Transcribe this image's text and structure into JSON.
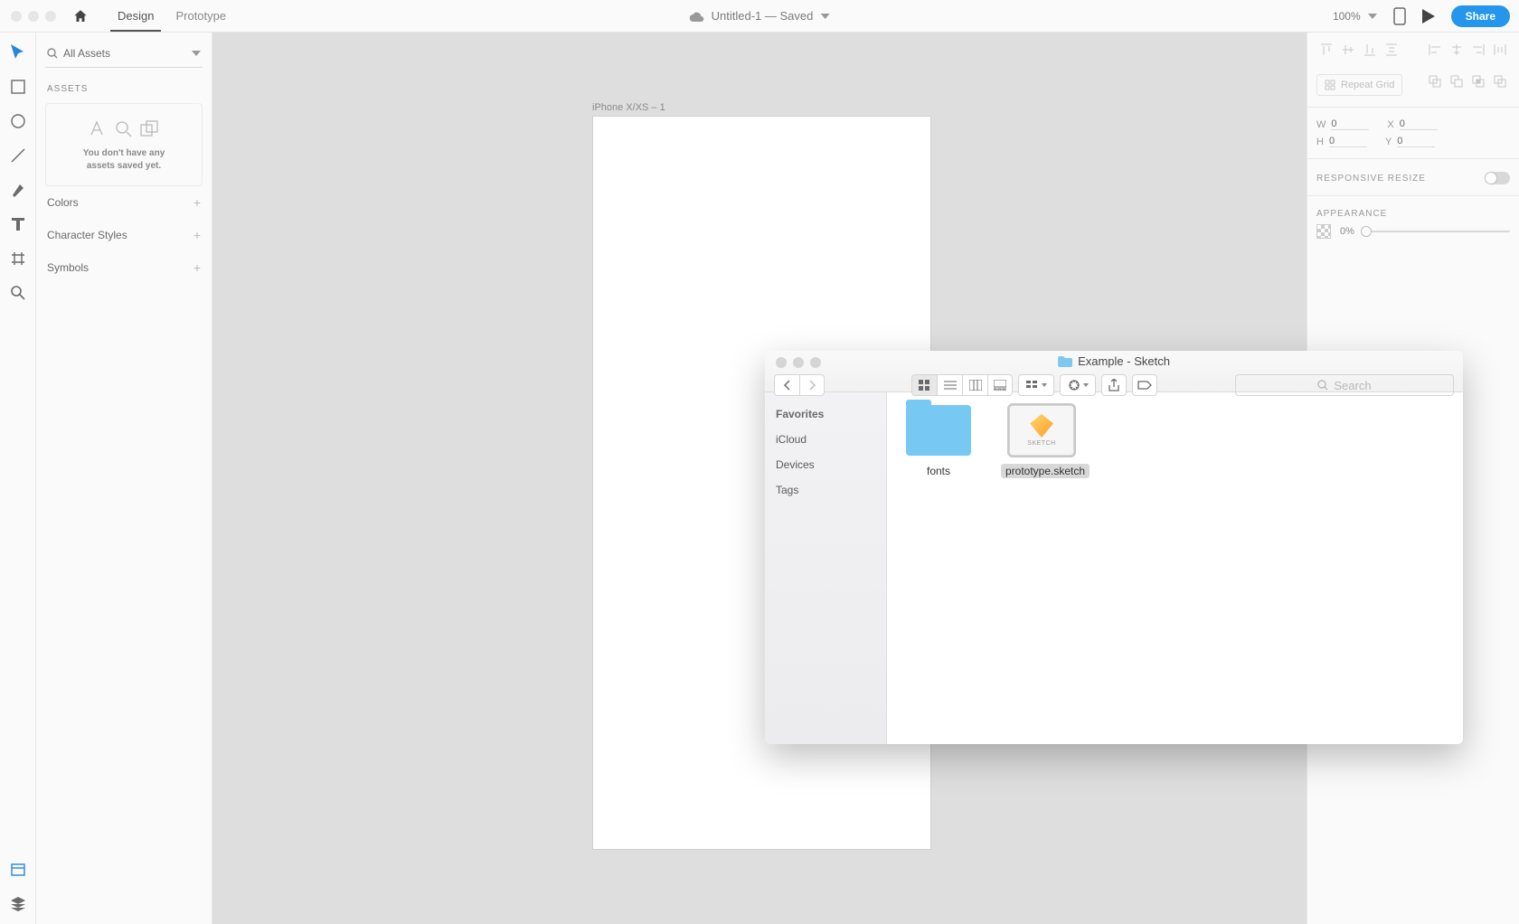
{
  "header": {
    "tab_design": "Design",
    "tab_prototype": "Prototype",
    "doc_title": "Untitled-1 — Saved",
    "zoom": "100%",
    "share": "Share"
  },
  "assets": {
    "search_label": "All Assets",
    "heading": "ASSETS",
    "empty_l1": "You don't have any",
    "empty_l2": "assets saved yet.",
    "colors": "Colors",
    "char_styles": "Character Styles",
    "symbols": "Symbols"
  },
  "artboard": {
    "label": "iPhone X/XS – 1"
  },
  "props": {
    "repeat": "Repeat Grid",
    "w": "W",
    "w_val": "0",
    "h": "H",
    "h_val": "0",
    "x": "X",
    "x_val": "0",
    "y": "Y",
    "y_val": "0",
    "responsive": "RESPONSIVE RESIZE",
    "appearance": "APPEARANCE",
    "opacity": "0%"
  },
  "finder": {
    "title": "Example - Sketch",
    "search_ph": "Search",
    "sidebar": {
      "favorites": "Favorites",
      "icloud": "iCloud",
      "devices": "Devices",
      "tags": "Tags"
    },
    "item_fonts": "fonts",
    "item_sketch": "prototype.sketch"
  }
}
